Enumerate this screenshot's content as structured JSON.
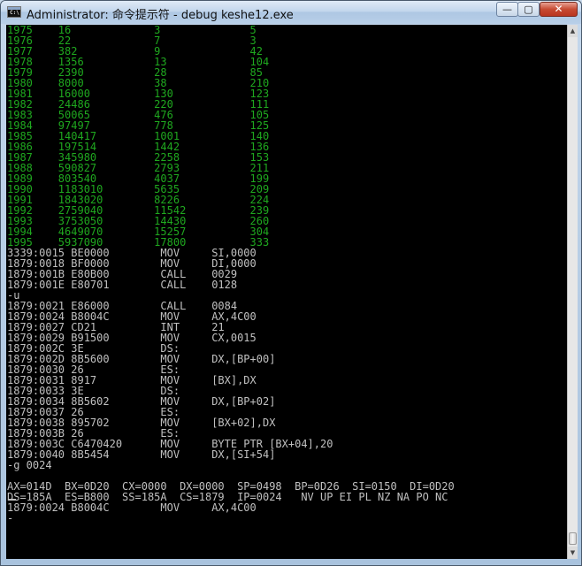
{
  "window": {
    "title": "Administrator: 命令提示符 - debug  keshe12.exe",
    "icon": "cmd-icon",
    "controls": {
      "minimize": "—",
      "maximize": "▢",
      "close": "✕"
    }
  },
  "console": {
    "colors": {
      "background": "#000000",
      "text": "#c0c0c0",
      "table_text": "#1fa81f"
    },
    "data_rows": [
      "1975    16             3              5",
      "1976    22             7              3",
      "1977    382            9              42",
      "1978    1356           13             104",
      "1979    2390           28             85",
      "1980    8000           38             210",
      "1981    16000          130            123",
      "1982    24486          220            111",
      "1983    50065          476            105",
      "1984    97497          778            125",
      "1985    140417         1001           140",
      "1986    197514         1442           136",
      "1987    345980         2258           153",
      "1988    590827         2793           211",
      "1989    803540         4037           199",
      "1990    1183010        5635           209",
      "1991    1843020        8226           224",
      "1992    2759040        11542          239",
      "1993    3753050        14430          260",
      "1994    4649070        15257          304",
      "1995    5937090        17800          333"
    ],
    "debug_lines": [
      "3339:0015 BE0000        MOV     SI,0000",
      "1879:0018 BF0000        MOV     DI,0000",
      "1879:001B E80B00        CALL    0029",
      "1879:001E E80701        CALL    0128",
      "-u",
      "1879:0021 E86000        CALL    0084",
      "1879:0024 B8004C        MOV     AX,4C00",
      "1879:0027 CD21          INT     21",
      "1879:0029 B91500        MOV     CX,0015",
      "1879:002C 3E            DS:",
      "1879:002D 8B5600        MOV     DX,[BP+00]",
      "1879:0030 26            ES:",
      "1879:0031 8917          MOV     [BX],DX",
      "1879:0033 3E            DS:",
      "1879:0034 8B5602        MOV     DX,[BP+02]",
      "1879:0037 26            ES:",
      "1879:0038 895702        MOV     [BX+02],DX",
      "1879:003B 26            ES:",
      "1879:003C C6470420      MOV     BYTE PTR [BX+04],20",
      "1879:0040 8B5454        MOV     DX,[SI+54]",
      "-g 0024",
      "",
      "AX=014D  BX=0D20  CX=0000  DX=0000  SP=0498  BP=0D26  SI=0150  DI=0D20",
      "DS=185A  ES=B800  SS=185A  CS=1879  IP=0024   NV UP EI PL NZ NA PO NC",
      "1879:0024 B8004C        MOV     AX,4C00",
      "-"
    ]
  }
}
